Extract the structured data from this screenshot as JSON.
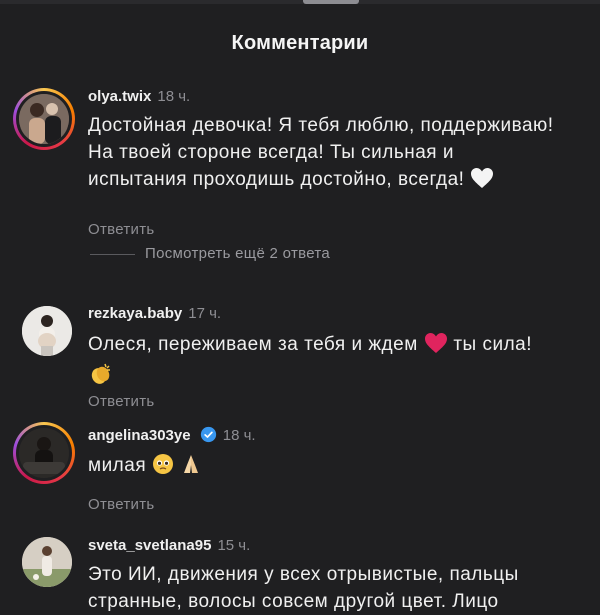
{
  "header": {
    "title": "Комментарии"
  },
  "comments": [
    {
      "username": "olya.twix",
      "time": "18 ч.",
      "text": "Достойная девочка! Я тебя люблю, поддерживаю! На твоей стороне всегда! Ты сильная и испытания проходишь достойно, всегда!",
      "emoji": "white-heart",
      "reply_label": "Ответить",
      "view_replies_label": "Посмотреть ещё 2 ответа"
    },
    {
      "username": "rezkaya.baby",
      "time": "17 ч.",
      "text_before": "Олеся, переживаем за тебя и ждем",
      "text_after": "ты сила!",
      "emoji": [
        "red-heart",
        "clapping-hands"
      ],
      "reply_label": "Ответить"
    },
    {
      "username": "angelina303ye",
      "time": "18 ч.",
      "verified": true,
      "text": "милая",
      "emoji": [
        "pleading-face",
        "folded-hands"
      ],
      "reply_label": "Ответить"
    },
    {
      "username": "sveta_svetlana95",
      "time": "15 ч.",
      "text": "Это ИИ, движения у всех отрывистые, пальцы странные, волосы совсем другой цвет. Лицо"
    }
  ],
  "colors": {
    "background": "#1f1f21",
    "muted": "#8e8e93",
    "verified": "#3897f0",
    "heart": "#e0245e"
  }
}
